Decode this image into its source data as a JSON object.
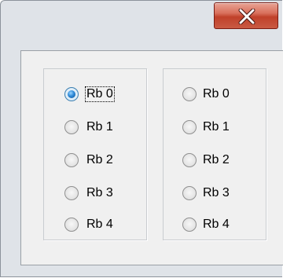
{
  "window": {
    "close_glyph": "close-icon"
  },
  "group_left": {
    "items": [
      {
        "label": "Rb 0",
        "checked": true
      },
      {
        "label": "Rb 1",
        "checked": false
      },
      {
        "label": "Rb 2",
        "checked": false
      },
      {
        "label": "Rb 3",
        "checked": false
      },
      {
        "label": "Rb 4",
        "checked": false
      }
    ]
  },
  "group_right": {
    "items": [
      {
        "label": "Rb 0",
        "checked": false
      },
      {
        "label": "Rb 1",
        "checked": false
      },
      {
        "label": "Rb 2",
        "checked": false
      },
      {
        "label": "Rb 3",
        "checked": false
      },
      {
        "label": "Rb 4",
        "checked": false
      }
    ]
  },
  "colors": {
    "close_button": "#c9513c",
    "radio_checked": "#2f8ad8"
  }
}
